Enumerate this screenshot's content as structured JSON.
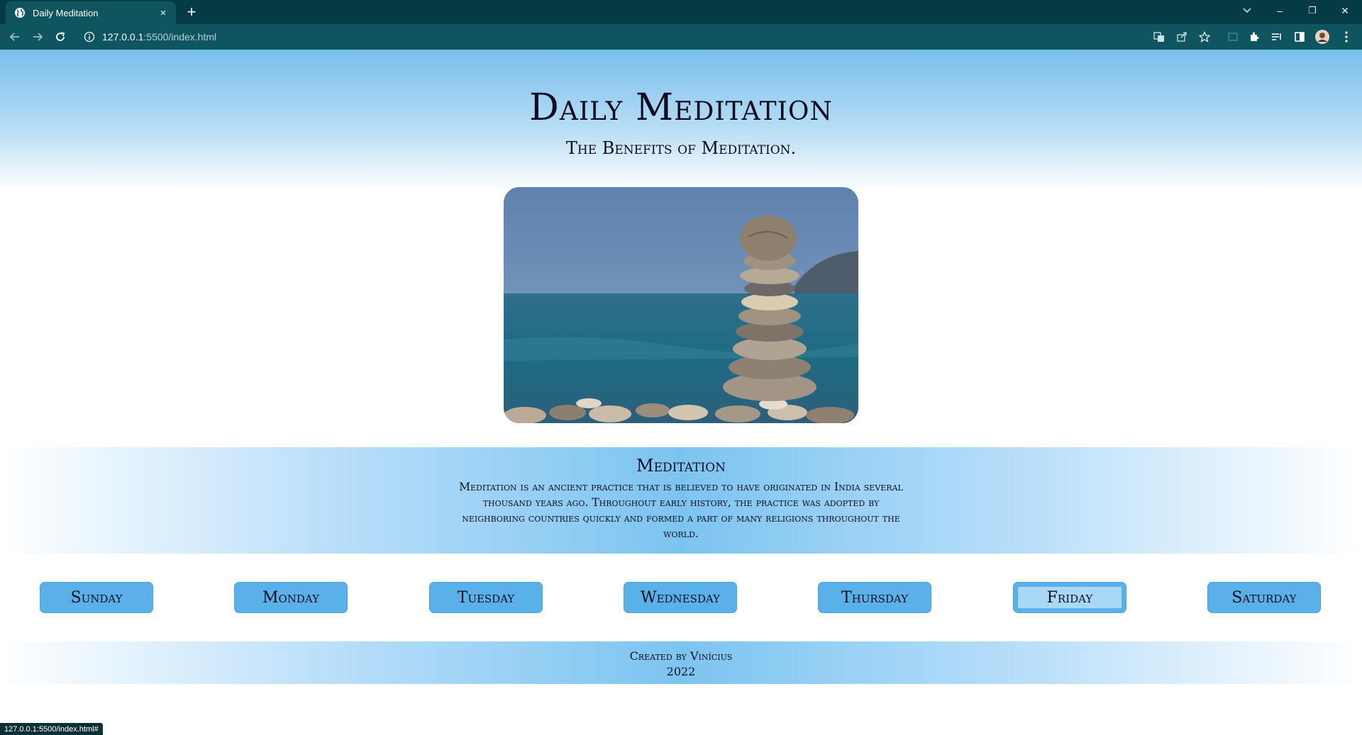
{
  "browser": {
    "tab_title": "Daily Meditation",
    "tab_close": "×",
    "new_tab": "+",
    "url_host": "127.0.0.1",
    "url_path": ":5500/index.html",
    "window_minimize": "–",
    "window_restore": "❐",
    "window_close": "✕",
    "status_url": "127.0.0.1:5500/index.html#"
  },
  "header": {
    "title": "Daily Meditation",
    "subtitle": "The Benefits of Meditation."
  },
  "about": {
    "heading": "Meditation",
    "text": "Meditation is an ancient practice that is believed to have originated in India several thousand years ago. Throughout early history, the practice was adopted by neighboring countries quickly and formed a part of many religions throughout the world."
  },
  "days": [
    {
      "label": "Sunday",
      "active": false
    },
    {
      "label": "Monday",
      "active": false
    },
    {
      "label": "Tuesday",
      "active": false
    },
    {
      "label": "Wednesday",
      "active": false
    },
    {
      "label": "Thursday",
      "active": false
    },
    {
      "label": "Friday",
      "active": true
    },
    {
      "label": "Saturday",
      "active": false
    }
  ],
  "footer": {
    "created_by": "Created by Vinícius",
    "year": "2022"
  },
  "colors": {
    "button": "#5ab0e8",
    "button_active": "#a9d8f6",
    "text": "#0c0c1e",
    "chrome": "#0f5560"
  },
  "icons": [
    "globe-favicon-icon",
    "back-arrow-icon",
    "forward-arrow-icon",
    "reload-icon",
    "info-icon",
    "translate-icon",
    "share-icon",
    "star-icon",
    "extensions-icon",
    "reading-list-icon",
    "side-panel-icon",
    "profile-avatar",
    "menu-kebab-icon"
  ]
}
